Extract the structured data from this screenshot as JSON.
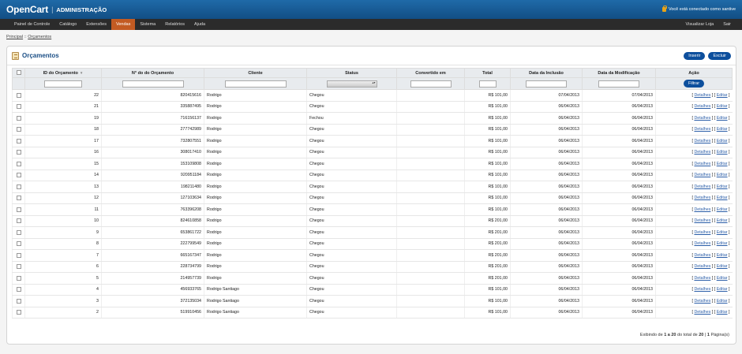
{
  "header": {
    "brand": "OpenCart",
    "separator": "|",
    "admin": "ADMINISTRAÇÃO",
    "login_text": "Você está conectado como santive"
  },
  "menu": {
    "left": [
      "Painel de Controle",
      "Catálogo",
      "Extensões",
      "Vendas",
      "Sistema",
      "Relatórios",
      "Ajuda"
    ],
    "active": "Vendas",
    "right": [
      "Visualizar Loja",
      "Sair"
    ]
  },
  "breadcrumb": {
    "home": "Principal",
    "sep": "::",
    "current": "Orçamentos"
  },
  "page": {
    "title": "Orçamentos",
    "insert_label": "Inserir",
    "delete_label": "Excluir",
    "filter_label": "Filtrar"
  },
  "columns": [
    "ID do Orçamento",
    "N° do do Orçamento",
    "Cliente",
    "Status",
    "Convertido em",
    "Total",
    "Data da Inclusão",
    "Data da Modificação",
    "Ação"
  ],
  "actions": {
    "details": "Detalhes",
    "edit": "Editar"
  },
  "rows": [
    {
      "id": "22",
      "num": "820415616",
      "cliente": "Rodrigo",
      "status": "Chegou",
      "total": "R$ 101,00",
      "inc": "07/04/2013",
      "mod": "07/04/2013"
    },
    {
      "id": "21",
      "num": "335887495",
      "cliente": "Rodrigo",
      "status": "Chegou",
      "total": "R$ 101,00",
      "inc": "06/04/2013",
      "mod": "06/04/2013"
    },
    {
      "id": "19",
      "num": "716156137",
      "cliente": "Rodrigo",
      "status": "Fechou",
      "total": "R$ 101,00",
      "inc": "06/04/2013",
      "mod": "06/04/2013"
    },
    {
      "id": "18",
      "num": "277742989",
      "cliente": "Rodrigo",
      "status": "Chegou",
      "total": "R$ 101,00",
      "inc": "06/04/2013",
      "mod": "06/04/2013"
    },
    {
      "id": "17",
      "num": "732807551",
      "cliente": "Rodrigo",
      "status": "Chegou",
      "total": "R$ 101,00",
      "inc": "06/04/2013",
      "mod": "06/04/2013"
    },
    {
      "id": "16",
      "num": "308017410",
      "cliente": "Rodrigo",
      "status": "Chegou",
      "total": "R$ 101,00",
      "inc": "06/04/2013",
      "mod": "06/04/2013"
    },
    {
      "id": "15",
      "num": "153109808",
      "cliente": "Rodrigo",
      "status": "Chegou",
      "total": "R$ 101,00",
      "inc": "06/04/2013",
      "mod": "06/04/2013"
    },
    {
      "id": "14",
      "num": "920951184",
      "cliente": "Rodrigo",
      "status": "Chegou",
      "total": "R$ 101,00",
      "inc": "06/04/2013",
      "mod": "06/04/2013"
    },
    {
      "id": "13",
      "num": "198211480",
      "cliente": "Rodrigo",
      "status": "Chegou",
      "total": "R$ 101,00",
      "inc": "06/04/2013",
      "mod": "06/04/2013"
    },
    {
      "id": "12",
      "num": "127103634",
      "cliente": "Rodrigo",
      "status": "Chegou",
      "total": "R$ 101,00",
      "inc": "06/04/2013",
      "mod": "06/04/2013"
    },
    {
      "id": "11",
      "num": "763396208",
      "cliente": "Rodrigo",
      "status": "Chegou",
      "total": "R$ 101,00",
      "inc": "06/04/2013",
      "mod": "06/04/2013"
    },
    {
      "id": "10",
      "num": "824610858",
      "cliente": "Rodrigo",
      "status": "Chegou",
      "total": "R$ 201,00",
      "inc": "06/04/2013",
      "mod": "06/04/2013"
    },
    {
      "id": "9",
      "num": "653861722",
      "cliente": "Rodrigo",
      "status": "Chegou",
      "total": "R$ 201,00",
      "inc": "06/04/2013",
      "mod": "06/04/2013"
    },
    {
      "id": "8",
      "num": "222799549",
      "cliente": "Rodrigo",
      "status": "Chegou",
      "total": "R$ 201,00",
      "inc": "06/04/2013",
      "mod": "06/04/2013"
    },
    {
      "id": "7",
      "num": "665167347",
      "cliente": "Rodrigo",
      "status": "Chegou",
      "total": "R$ 201,00",
      "inc": "06/04/2013",
      "mod": "06/04/2013"
    },
    {
      "id": "6",
      "num": "228734799",
      "cliente": "Rodrigo",
      "status": "Chegou",
      "total": "R$ 201,00",
      "inc": "06/04/2013",
      "mod": "06/04/2013"
    },
    {
      "id": "5",
      "num": "214957739",
      "cliente": "Rodrigo",
      "status": "Chegou",
      "total": "R$ 201,00",
      "inc": "06/04/2013",
      "mod": "06/04/2013"
    },
    {
      "id": "4",
      "num": "456933765",
      "cliente": "Rodrigo Santiago",
      "status": "Chegou",
      "total": "R$ 101,00",
      "inc": "06/04/2013",
      "mod": "06/04/2013"
    },
    {
      "id": "3",
      "num": "372135034",
      "cliente": "Rodrigo Santiago",
      "status": "Chegou",
      "total": "R$ 101,00",
      "inc": "06/04/2013",
      "mod": "06/04/2013"
    },
    {
      "id": "2",
      "num": "519910456",
      "cliente": "Rodrigo Santiago",
      "status": "Chegou",
      "total": "R$ 101,00",
      "inc": "06/04/2013",
      "mod": "06/04/2013"
    }
  ],
  "pagination": {
    "prefix": "Exibindo de",
    "range": "1 a 20",
    "middle": "do total de",
    "total": "20",
    "pages": "1",
    "suffix": "Página(s)"
  }
}
